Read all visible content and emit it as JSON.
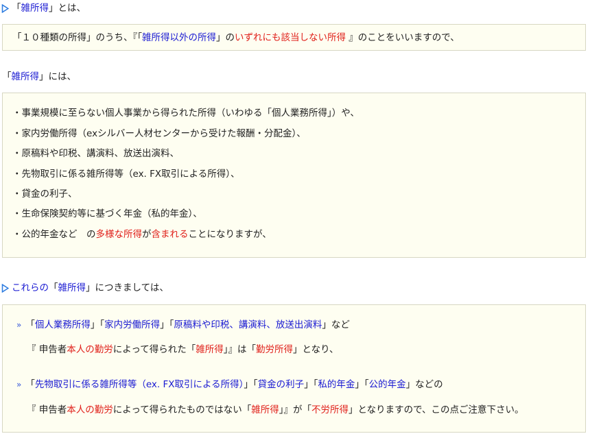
{
  "heading1": {
    "q_open": "「",
    "term": "雑所得",
    "q_close": "」",
    "rest": "とは、"
  },
  "box1": {
    "p1": "「１０種類の所得」のうち、『「",
    "p2": "雑所得以外の所得",
    "p3": "」の",
    "p4": "いずれにも該当しない所得",
    "p5": " 』のことをいいますので、"
  },
  "heading2": {
    "q_open": "「",
    "term": "雑所得",
    "q_close": "」",
    "rest": "には、"
  },
  "box2": {
    "items": [
      "・事業規模に至らない個人事業から得られた所得（いわゆる「個人業務所得」）や、",
      "・家内労働所得（exシルバー人材センターから受けた報酬・分配金）、",
      "・原稿料や印税、講演料、放送出演料、",
      "・先物取引に係る雑所得等（ex. FX取引による所得）、",
      "・貸金の利子、",
      "・生命保険契約等に基づく年金（私的年金）、"
    ],
    "last": {
      "p1": "・公的年金など　の",
      "red1": "多様な所得",
      "p2": "が",
      "red2": "含まれる",
      "p3": "ことになりますが、"
    }
  },
  "heading3": {
    "lead": "これらの",
    "q_open": "「",
    "term": "雑所得",
    "q_close": "」",
    "rest": "につきましては、"
  },
  "box3": {
    "bullet": "»",
    "g1": {
      "q1o": "「",
      "t1": "個人業務所得",
      "q1c": "」",
      "q2o": "「",
      "t2": "家内労働所得",
      "q2c": "」",
      "q3o": "「",
      "t3": "原稿料や印税、講演料、放送出演料",
      "q3c": "」",
      "tail": "など"
    },
    "g1b": {
      "p1": "『 申告者",
      "red1": "本人の勤労",
      "p2": "によって得られた「",
      "red2": "雑所得",
      "p3": "」』は「",
      "red3": "勤労所得",
      "p4": "」となり、"
    },
    "g2": {
      "q1o": "「",
      "t1": "先物取引に係る雑所得等（ex. FX取引による所得）",
      "q1c": "」",
      "q2o": "「",
      "t2": "貸金の利子",
      "q2c": "」",
      "q3o": "「",
      "t3": "私的年金",
      "q3c": "」",
      "q4o": "「",
      "t4": "公的年金",
      "q4c": "」",
      "tail": "などの"
    },
    "g2b": {
      "p1": "『 申告者",
      "red1": "本人の勤労",
      "p2": "によって得られたものではない「",
      "red2": "雑所得",
      "p3": "」』が「",
      "red3": "不労所得",
      "p4": "」となりますので、この点ご注意下さい。"
    }
  },
  "colors": {
    "blue_text": "#1a1ad2",
    "red_text": "#e0201a",
    "box_bg": "#fefef1",
    "box_border": "#d7d7c2",
    "triangle": "#2f7de0"
  }
}
